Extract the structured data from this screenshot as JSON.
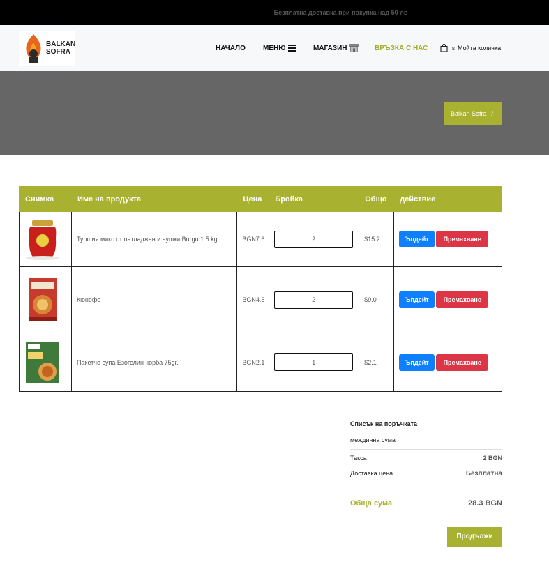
{
  "topbar": {
    "text": "Безплатна доставка при покупка над 50 лв"
  },
  "brand": {
    "line1": "BALKAN",
    "line2": "SOFRA"
  },
  "nav": {
    "home": "НАЧАЛО",
    "menu": "МЕНЮ",
    "shop": "МАГАЗИН",
    "contact": "ВРЪЗКА С НАС",
    "cart_count": "s",
    "cart_label": "Мойта количка"
  },
  "breadcrumb": {
    "site": "Balkan Sofra",
    "sep": "/"
  },
  "table": {
    "headers": [
      "Снимка",
      "Име на продукта",
      "Цена",
      "Бройка",
      "Общо",
      "действие"
    ],
    "rows": [
      {
        "name": "Туршия микс от патладжан и чушки Burgu 1.5 kg",
        "price": "BGN7.6",
        "qty": "2",
        "total": "$15.2",
        "image": "jar-red"
      },
      {
        "name": "Кюнефе",
        "price": "BGN4.5",
        "qty": "2",
        "total": "$9.0",
        "image": "dessert-pack"
      },
      {
        "name": "Пакетче супа Езогелин чорба 75gr.",
        "price": "BGN2.1",
        "qty": "1",
        "total": "$2.1",
        "image": "soup-pack"
      }
    ],
    "update_label": "Ъпдейт",
    "remove_label": "Премахване"
  },
  "summary": {
    "title": "Списък на поръчката",
    "subtotal_label": "междинна сума",
    "tax_label": "Такса",
    "tax_value": "2 BGN",
    "delivery_label": "Доставка цена",
    "delivery_value": "Безплатна",
    "total_label": "Обща сума",
    "total_value": "28.3 BGN",
    "checkout_label": "Продължи"
  },
  "colors": {
    "accent": "#a9b230",
    "update": "#0d7fff",
    "remove": "#dc3545"
  }
}
